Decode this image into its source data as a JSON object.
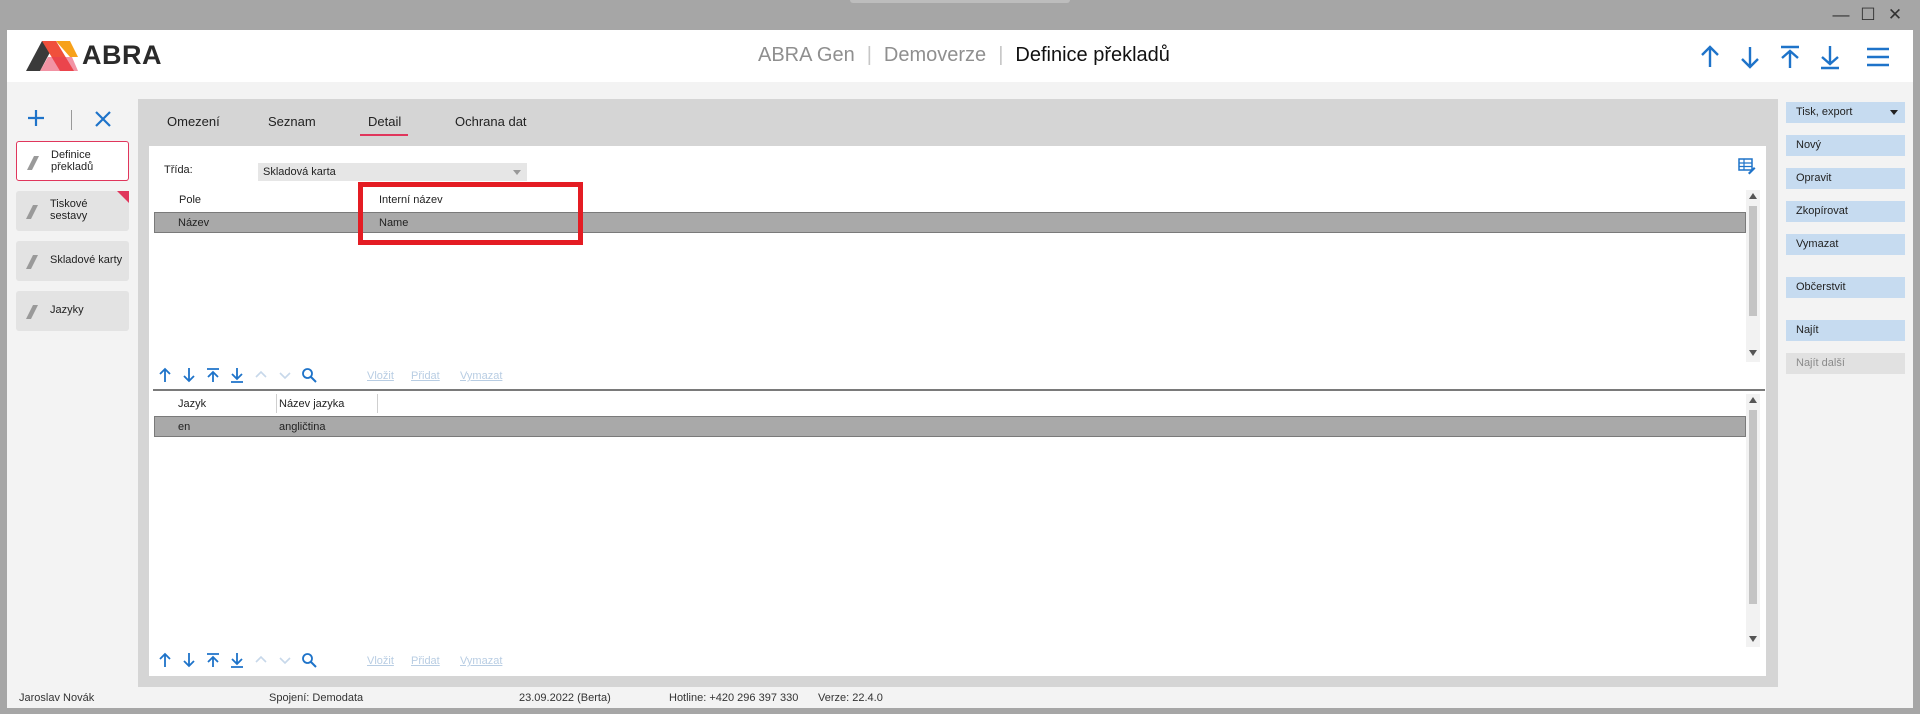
{
  "window": {
    "controls": {
      "minimize": "—",
      "maximize": "☐",
      "close": "✕"
    }
  },
  "header": {
    "logo_text": "ABRA",
    "app_name": "ABRA Gen",
    "edition": "Demoverze",
    "current_page": "Definice překladů",
    "icons": [
      "arrow-up-icon",
      "arrow-down-icon",
      "arrow-to-top-icon",
      "arrow-to-bottom-icon",
      "hamburger-menu-icon"
    ]
  },
  "sidebar": {
    "items": [
      {
        "label": "Definice překladů",
        "active": true
      },
      {
        "label": "Tiskové sestavy",
        "flag": true
      },
      {
        "label": "Skladové karty"
      },
      {
        "label": "Jazyky"
      }
    ]
  },
  "tabs": [
    {
      "label": "Omezení"
    },
    {
      "label": "Seznam"
    },
    {
      "label": "Detail",
      "active": true
    },
    {
      "label": "Ochrana dat"
    }
  ],
  "detail": {
    "trida_label": "Třída:",
    "trida_value": "Skladová karta",
    "grid1": {
      "headers": [
        "Pole",
        "Interní název"
      ],
      "rows": [
        [
          "Název",
          "Name"
        ]
      ]
    },
    "grid2": {
      "headers": [
        "Jazyk",
        "Název jazyka"
      ],
      "rows": [
        [
          "en",
          "angličtina"
        ]
      ]
    },
    "toolbar": {
      "insert": "Vložit",
      "add": "Přidat",
      "delete": "Vymazat"
    }
  },
  "actions": {
    "print_export": "Tisk, export",
    "new": "Nový",
    "edit": "Opravit",
    "copy": "Zkopírovat",
    "delete": "Vymazat",
    "refresh": "Občerstvit",
    "find": "Najít",
    "find_next": "Najít další"
  },
  "status": {
    "user": "Jaroslav Novák",
    "connection": "Spojení: Demodata",
    "date": "23.09.2022 (Berta)",
    "hotline": "Hotline: +420 296 397 330",
    "version": "Verze: 22.4.0"
  },
  "colors": {
    "accent": "#e0365c",
    "primary_icon": "#1e73c9",
    "button_bg": "#c6dbf0",
    "highlight_box": "#e41c23",
    "selected_row": "#a9a9a9"
  }
}
